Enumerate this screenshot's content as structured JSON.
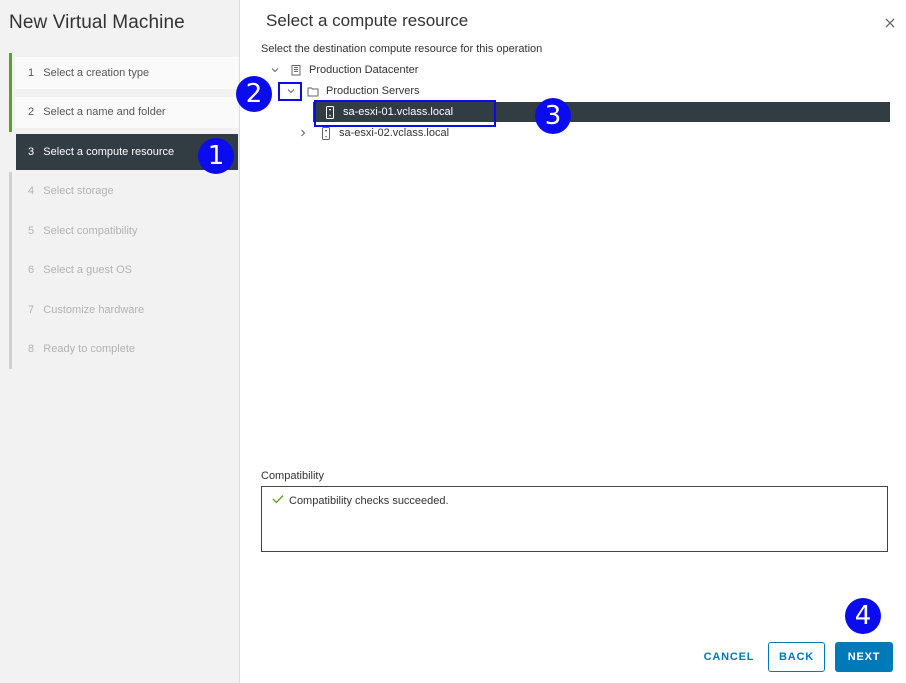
{
  "wizard": {
    "title": "New Virtual Machine",
    "steps": [
      {
        "num": "1",
        "label": "Select a creation type"
      },
      {
        "num": "2",
        "label": "Select a name and folder"
      },
      {
        "num": "3",
        "label": "Select a compute resource"
      },
      {
        "num": "4",
        "label": "Select storage"
      },
      {
        "num": "5",
        "label": "Select compatibility"
      },
      {
        "num": "6",
        "label": "Select a guest OS"
      },
      {
        "num": "7",
        "label": "Customize hardware"
      },
      {
        "num": "8",
        "label": "Ready to complete"
      }
    ],
    "current_step": 3
  },
  "main": {
    "title": "Select a compute resource",
    "subtitle": "Select the destination compute resource for this operation",
    "tree": {
      "datacenter": "Production Datacenter",
      "folder": "Production Servers",
      "hosts": [
        "sa-esxi-01.vclass.local",
        "sa-esxi-02.vclass.local"
      ],
      "selected_host": "sa-esxi-01.vclass.local"
    },
    "compatibility": {
      "label": "Compatibility",
      "message": "Compatibility checks succeeded."
    }
  },
  "buttons": {
    "cancel": "CANCEL",
    "back": "BACK",
    "next": "NEXT"
  },
  "annotations": [
    "1",
    "2",
    "3",
    "4"
  ],
  "colors": {
    "accent": "#0079b8",
    "selected_bg": "#313c43",
    "done_bar": "#5aa220",
    "annotation": "#0b0bf0",
    "success": "#5aa220"
  }
}
